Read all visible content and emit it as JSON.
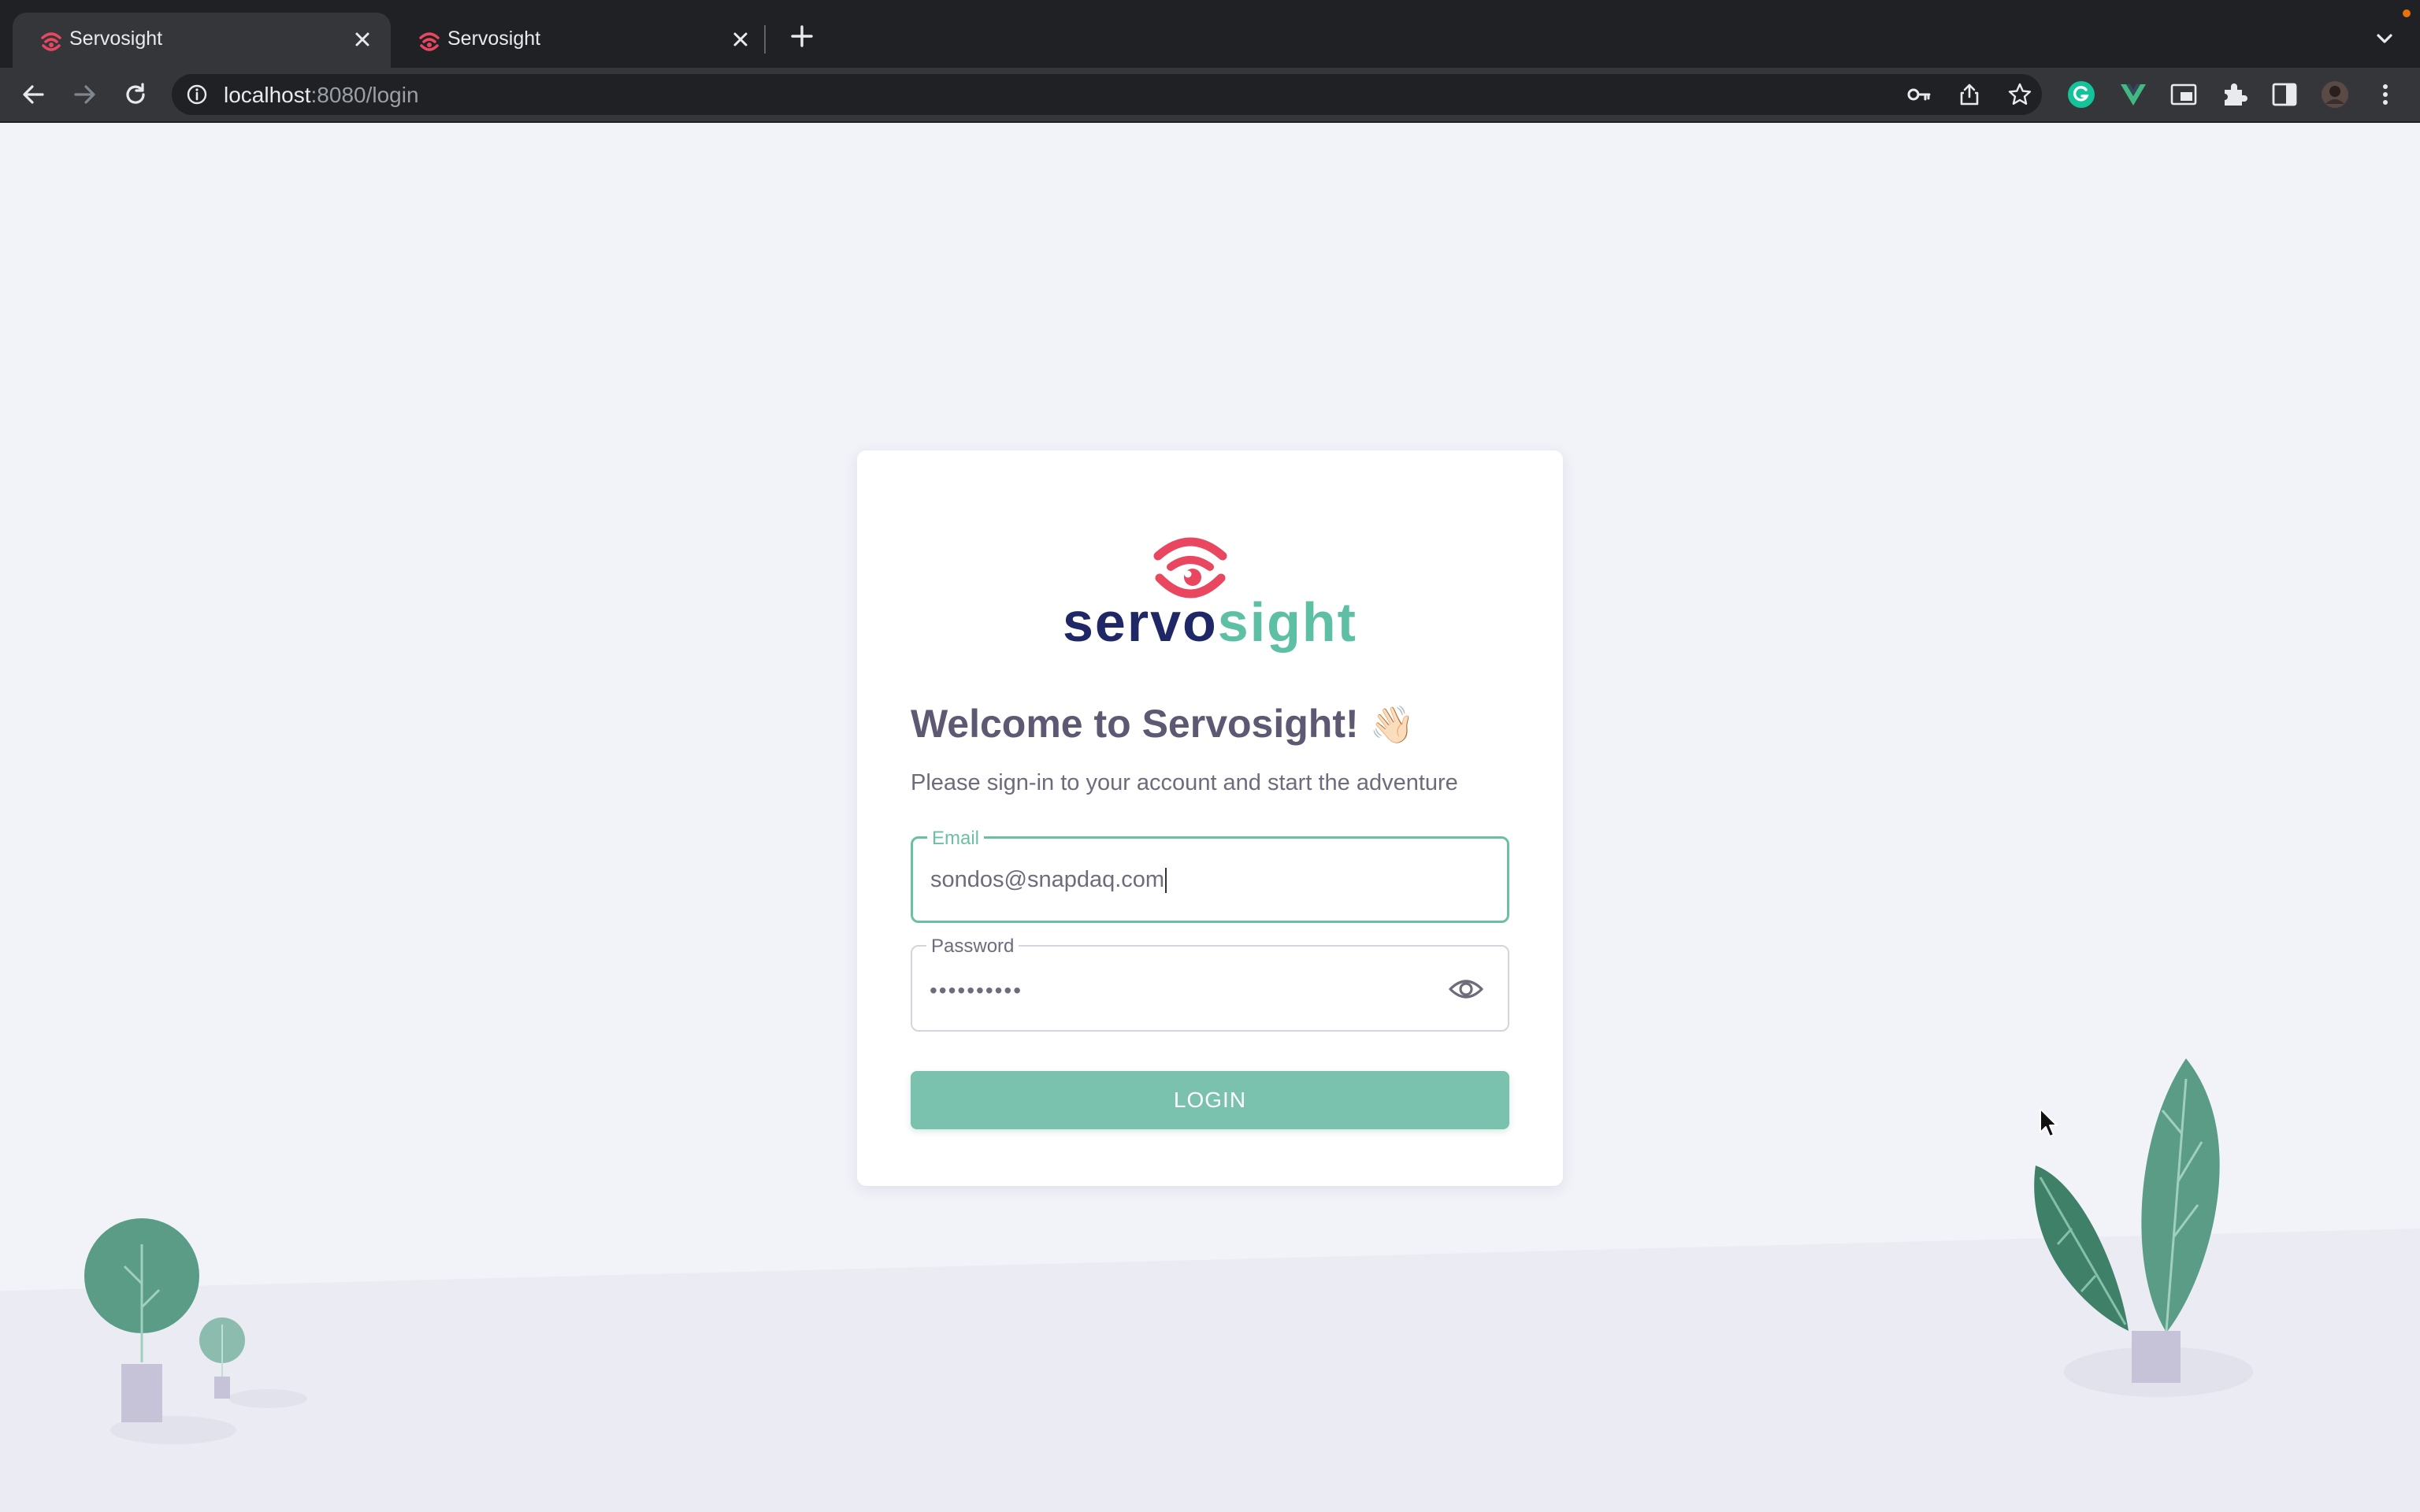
{
  "browser": {
    "tabs": [
      {
        "title": "Servosight",
        "active": true
      },
      {
        "title": "Servosight",
        "active": false
      }
    ],
    "address": {
      "host": "localhost",
      "rest": ":8080/login"
    }
  },
  "brand": {
    "part1": "servo",
    "part2": "sight",
    "color_primary": "#1f2766",
    "color_accent": "#5dbfa3",
    "color_mark": "#e8475f"
  },
  "login": {
    "welcome": "Welcome to Servosight!",
    "wave_emoji": "👋🏻",
    "subtitle": "Please sign-in to your account and start the adventure",
    "email_label": "Email",
    "email_value": "sondos@snapdaq.com",
    "password_label": "Password",
    "password_mask": "••••••••••",
    "button": "LOGIN"
  },
  "icons": [
    "servosight-favicon",
    "close-icon",
    "new-tab-icon",
    "back-icon",
    "forward-icon",
    "reload-icon",
    "info-icon",
    "key-icon",
    "share-icon",
    "star-icon",
    "grammarly-icon",
    "vue-devtools-icon",
    "picture-in-picture-icon",
    "extensions-icon",
    "side-panel-icon",
    "profile-avatar",
    "menu-icon",
    "eye-icon"
  ]
}
